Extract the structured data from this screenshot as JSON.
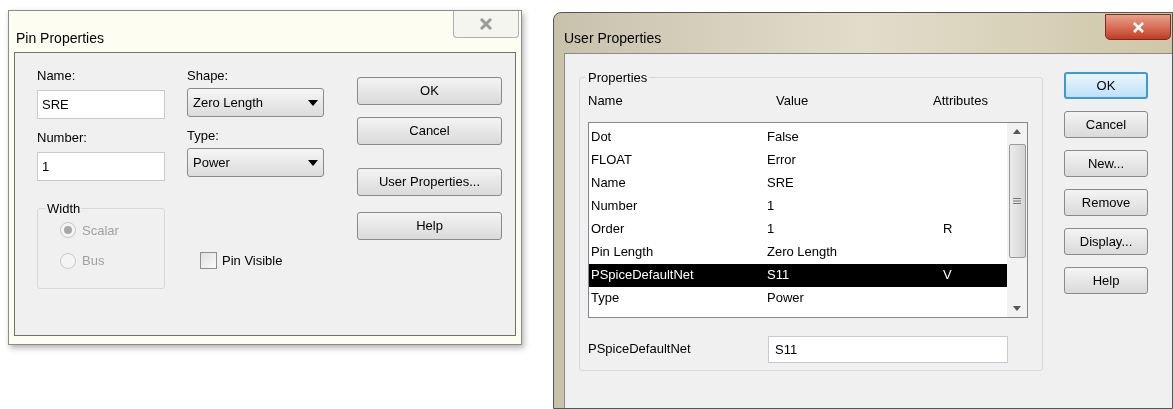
{
  "pin_properties": {
    "title": "Pin Properties",
    "name_field": {
      "label": "Name:",
      "value": "SRE"
    },
    "number_field": {
      "label": "Number:",
      "value": "1"
    },
    "shape": {
      "label": "Shape:",
      "value": "Zero Length"
    },
    "type": {
      "label": "Type:",
      "value": "Power"
    },
    "width_group": {
      "label": "Width",
      "disabled": true,
      "options": [
        {
          "label": "Scalar",
          "selected": true
        },
        {
          "label": "Bus",
          "selected": false
        }
      ]
    },
    "pin_visible": {
      "label": "Pin Visible",
      "checked": false
    },
    "buttons": [
      "OK",
      "Cancel",
      "User Properties...",
      "Help"
    ]
  },
  "user_properties": {
    "title": "User Properties",
    "group_label": "Properties",
    "columns": [
      "Name",
      "Value",
      "Attributes"
    ],
    "rows": [
      {
        "name": "Dot",
        "value": "False",
        "attributes": "",
        "selected": false
      },
      {
        "name": "FLOAT",
        "value": "Error",
        "attributes": "",
        "selected": false
      },
      {
        "name": "Name",
        "value": "SRE",
        "attributes": "",
        "selected": false
      },
      {
        "name": "Number",
        "value": "1",
        "attributes": "",
        "selected": false
      },
      {
        "name": "Order",
        "value": "1",
        "attributes": "R",
        "selected": false
      },
      {
        "name": "Pin Length",
        "value": "Zero Length",
        "attributes": "",
        "selected": false
      },
      {
        "name": "PSpiceDefaultNet",
        "value": "S11",
        "attributes": "V",
        "selected": true
      },
      {
        "name": "Type",
        "value": "Power",
        "attributes": "",
        "selected": false
      }
    ],
    "edit_field": {
      "label": "PSpiceDefaultNet",
      "value": "S11"
    },
    "buttons": [
      {
        "label": "OK",
        "default": true
      },
      {
        "label": "Cancel",
        "default": false
      },
      {
        "label": "New...",
        "default": false
      },
      {
        "label": "Remove",
        "default": false
      },
      {
        "label": "Display...",
        "default": false
      },
      {
        "label": "Help",
        "default": false
      }
    ]
  }
}
